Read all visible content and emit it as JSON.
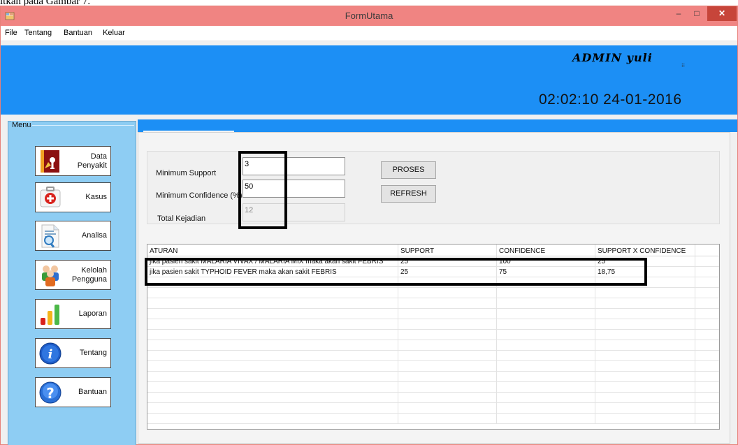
{
  "document_fragment": "itkan pada Gambar 7.",
  "window": {
    "title": "FormUtama"
  },
  "window_controls": {
    "minimize": "–",
    "maximize": "□",
    "close": "✕"
  },
  "menubar": {
    "items": [
      "File",
      "Tentang",
      "Bantuan",
      "Keluar"
    ]
  },
  "header": {
    "admin_label": "ADMIN yuli",
    "clock": "02:02:10 24-01-2016",
    "band_color": "#1c8ff5"
  },
  "sidebar": {
    "legend": "Menu",
    "buttons": [
      {
        "label": "Data\nPenyakit",
        "icon": "book-icon"
      },
      {
        "label": "Kasus",
        "icon": "first-aid-icon"
      },
      {
        "label": "Analisa",
        "icon": "magnifier-document-icon"
      },
      {
        "label": "Kelolah\nPengguna",
        "icon": "users-icon"
      },
      {
        "label": "Laporan",
        "icon": "bar-chart-icon"
      },
      {
        "label": "Tentang",
        "icon": "info-icon"
      },
      {
        "label": "Bantuan",
        "icon": "help-icon"
      }
    ]
  },
  "form": {
    "min_support_label": "Minimum Support",
    "min_support_value": "3",
    "min_confidence_label": "Minimum Confidence (%)",
    "min_confidence_value": "50",
    "total_kejadian_label": "Total Kejadian",
    "total_kejadian_value": "12",
    "proses_button": "PROSES",
    "refresh_button": "REFRESH"
  },
  "grid": {
    "columns": [
      "ATURAN",
      "SUPPORT",
      "CONFIDENCE",
      "SUPPORT X CONFIDENCE"
    ],
    "rows": [
      {
        "aturan": "jika pasien sakit MALARIA VIVAX / MALARIA MIX maka akan sakit FEBRIS",
        "support": "25",
        "confidence": "100",
        "support_x_confidence": "25"
      },
      {
        "aturan": "jika pasien sakit TYPHOID FEVER maka akan sakit FEBRIS",
        "support": "25",
        "confidence": "75",
        "support_x_confidence": "18,75"
      }
    ],
    "empty_rows": 14
  }
}
